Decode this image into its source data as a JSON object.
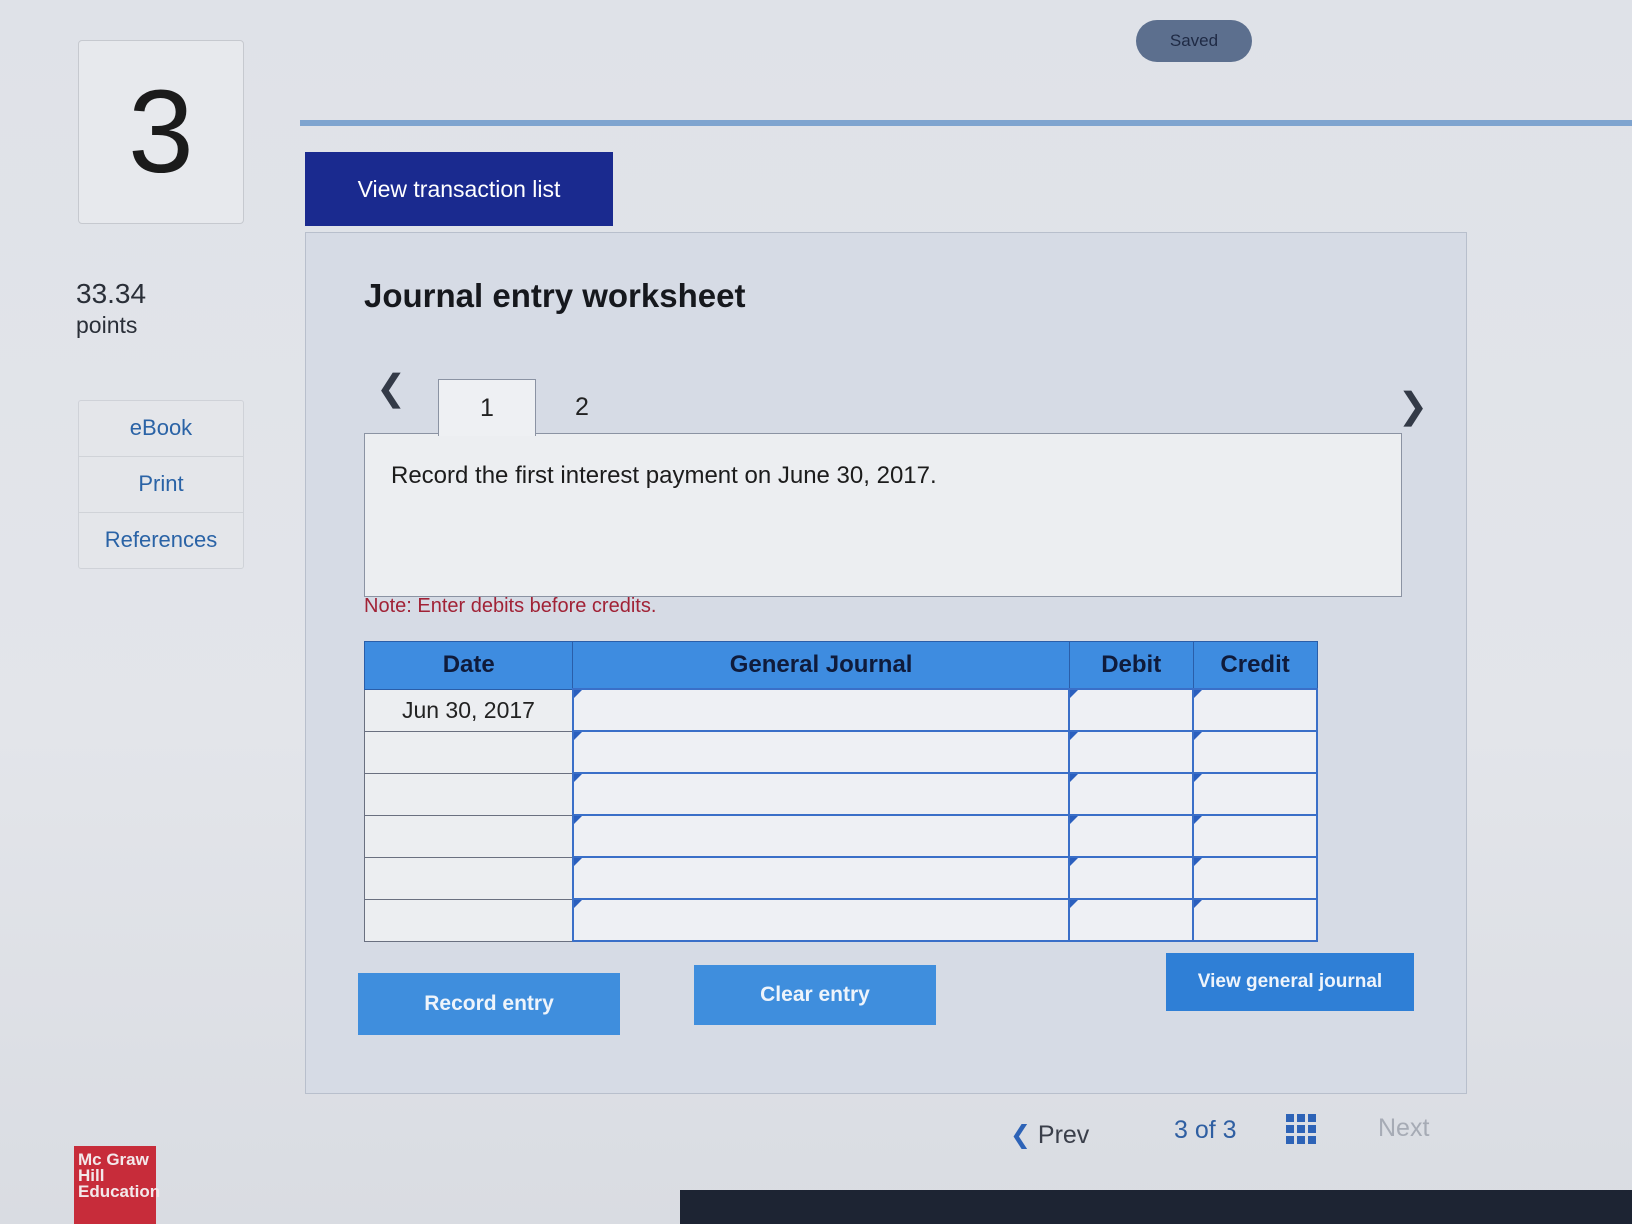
{
  "status": {
    "saved_label": "Saved"
  },
  "question": {
    "number": "3",
    "points_value": "33.34",
    "points_label": "points"
  },
  "sidebar": {
    "links": [
      "eBook",
      "Print",
      "References"
    ]
  },
  "toolbar": {
    "view_transactions_label": "View transaction list"
  },
  "worksheet": {
    "title": "Journal entry worksheet",
    "tabs": [
      "1",
      "2"
    ],
    "active_tab": "1",
    "prompt": "Record the first interest payment on June 30, 2017.",
    "note": "Note: Enter debits before credits.",
    "table": {
      "headers": [
        "Date",
        "General Journal",
        "Debit",
        "Credit"
      ],
      "rows": [
        {
          "date": "Jun 30, 2017"
        },
        {
          "date": ""
        },
        {
          "date": ""
        },
        {
          "date": ""
        },
        {
          "date": ""
        },
        {
          "date": ""
        }
      ]
    },
    "buttons": {
      "record_entry": "Record entry",
      "clear_entry": "Clear entry",
      "view_general_journal": "View general journal"
    }
  },
  "pager": {
    "prev_label": "Prev",
    "position": "3 of 3",
    "next_label": "Next"
  },
  "brand": {
    "logo_text": "Mc Graw Hill Education"
  }
}
